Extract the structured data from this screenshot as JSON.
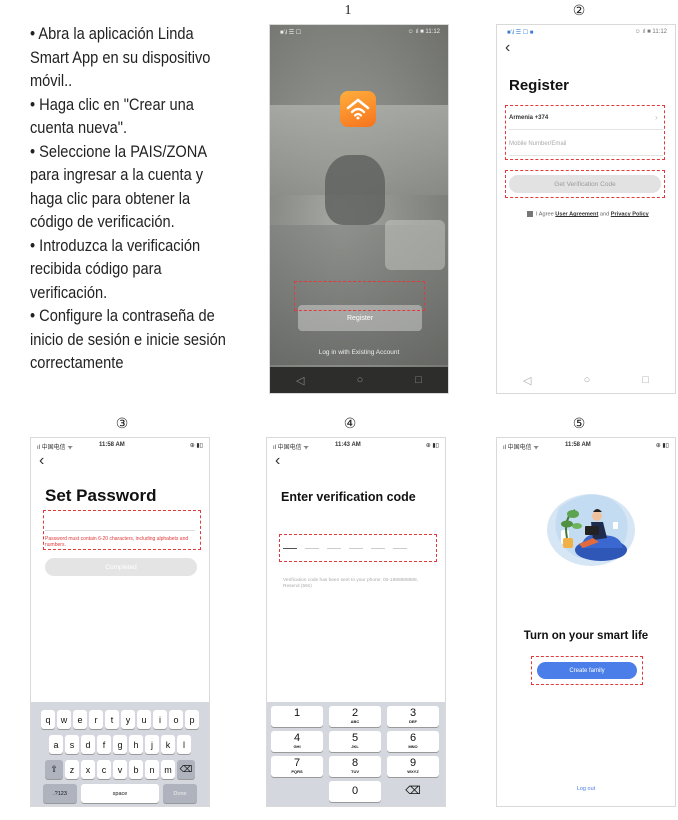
{
  "instructions": [
    "• Abra la aplicación Linda Smart App en su dispositivo móvil..",
    "•  Haga clic en \"Crear una cuenta nueva\".",
    "• Seleccione la PAIS/ZONA para ingresar a la cuenta y haga clic para obtener la código de verificación.",
    "• Introduzca la verificación recibida código para verificación.",
    "• Configure la contraseña de inicio de sesión e inicie sesión correctamente"
  ],
  "step_numbers": [
    "1",
    "②",
    "③",
    "④",
    "⑤"
  ],
  "phone1": {
    "status_left": "■'ᵢl ☰ ☐",
    "status_right": "☺ ıl ■ 11:12",
    "register_label": "Register",
    "login_label": "Log in with Existing Account"
  },
  "phone2": {
    "status_left": "■'ᵢl ☰ ☐ ■",
    "status_right": "☺ ıl ■ 11:12",
    "back": "‹",
    "title": "Register",
    "country": "Armenia +374",
    "country_chevron": "›",
    "mobile_placeholder": "Mobile Number/Email",
    "get_code_label": "Get Verification Code",
    "agree_text": "I Agree",
    "user_agreement": "User Agreement",
    "and": "and",
    "privacy_policy": "Privacy Policy"
  },
  "phone3": {
    "status_left": "ıl 中国电信 ᯤ",
    "status_time": "11:58 AM",
    "status_right": "⊕ ▮▯",
    "back": "‹",
    "title": "Set Password",
    "hint": "Password must contain 6-20 characters, including alphabets and numbers.",
    "completed_label": "Completed",
    "keyboard_row1": [
      "q",
      "w",
      "e",
      "r",
      "t",
      "y",
      "u",
      "i",
      "o",
      "p"
    ],
    "keyboard_row2": [
      "a",
      "s",
      "d",
      "f",
      "g",
      "h",
      "j",
      "k",
      "l"
    ],
    "keyboard_row3": [
      "z",
      "x",
      "c",
      "v",
      "b",
      "n",
      "m"
    ],
    "shift": "⇧",
    "delete": "⌫",
    "key_123": ".?123",
    "space": "space",
    "done": "Done"
  },
  "phone4": {
    "status_left": "ıl 中国电信 ᯤ",
    "status_time": "11:43 AM",
    "status_right": "⊕ ▮▯",
    "back": "‹",
    "title": "Enter verification code",
    "sent_text": "Verification code has been sent to your phone: 00-1888888888, Resend (56s)",
    "numpad": [
      {
        "num": "1",
        "letters": ""
      },
      {
        "num": "2",
        "letters": "ABC"
      },
      {
        "num": "3",
        "letters": "DEF"
      },
      {
        "num": "4",
        "letters": "GHI"
      },
      {
        "num": "5",
        "letters": "JKL"
      },
      {
        "num": "6",
        "letters": "MNO"
      },
      {
        "num": "7",
        "letters": "PQRS"
      },
      {
        "num": "8",
        "letters": "TUV"
      },
      {
        "num": "9",
        "letters": "WXYZ"
      },
      {
        "num": "0",
        "letters": ""
      }
    ],
    "delete": "⌫"
  },
  "phone5": {
    "status_left": "ıl 中国电信 ᯤ",
    "status_time": "11:58 AM",
    "status_right": "⊕ ▮▯",
    "heading": "Turn on your smart life",
    "create_family_label": "Create family",
    "logout_label": "Log out"
  },
  "colors": {
    "accent_orange": "#f7731c",
    "dashed_highlight": "#e23a3a",
    "button_blue": "#4b7ee8",
    "hint_red": "#e23a3a"
  }
}
